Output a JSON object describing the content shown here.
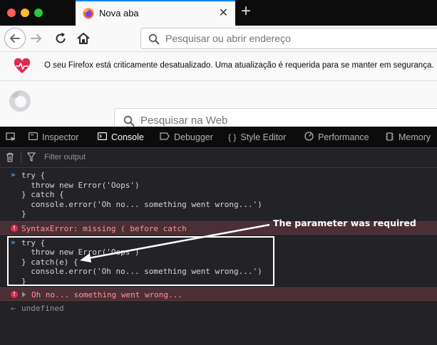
{
  "window": {
    "tab_title": "Nova aba",
    "new_tab_symbol": "+",
    "tab_close_symbol": "✕"
  },
  "navbar": {
    "url_placeholder": "Pesquisar ou abrir endereço"
  },
  "notification": {
    "message": "O seu Firefox está criticamente desatualizado. Uma atualização é requerida para se manter em segurança.",
    "icon": "heart-pulse-icon"
  },
  "content": {
    "web_search_placeholder": "Pesquisar na Web"
  },
  "devtools": {
    "tabs": [
      {
        "label": "Inspector",
        "icon": "inspector-icon"
      },
      {
        "label": "Console",
        "icon": "console-icon"
      },
      {
        "label": "Debugger",
        "icon": "debugger-icon"
      },
      {
        "label": "Style Editor",
        "icon": "style-editor-icon"
      },
      {
        "label": "Performance",
        "icon": "performance-icon"
      },
      {
        "label": "Memory",
        "icon": "memory-icon"
      }
    ],
    "selected_tab": "Console",
    "filter_placeholder": "Filter output"
  },
  "console": {
    "first_input": [
      "try {",
      "  throw new Error('Oops')",
      "} catch {",
      "  console.error('Oh no... something went wrong...')",
      "}"
    ],
    "syntax_error": "SyntaxError: missing ( before catch",
    "second_input": [
      "try {",
      "  throw new Error('Oops')",
      "} catch(e) {",
      "  console.error('Oh no... something went wrong...')",
      "}"
    ],
    "logged_error": "Oh no... something went wrong...",
    "result": "undefined",
    "prompt_symbol": "»",
    "result_symbol": "←"
  },
  "annotation": {
    "callout": "The parameter was required"
  },
  "colors": {
    "accent": "#0a84ff",
    "error_bg": "#4b2f36",
    "error_text": "#ff9595",
    "heart": "#e22850"
  }
}
